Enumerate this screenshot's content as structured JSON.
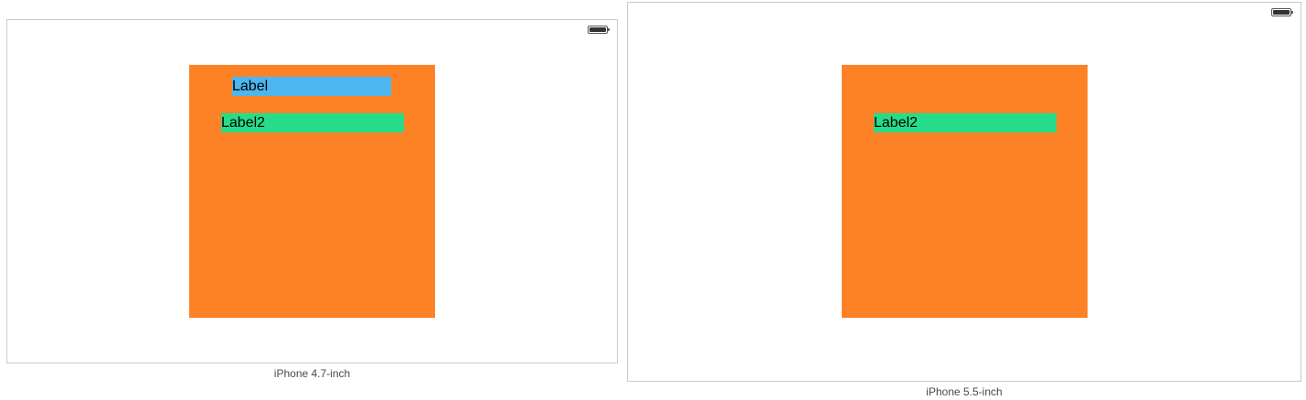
{
  "colors": {
    "orange_view": "#fd8226",
    "label_blue": "#4cb6f0",
    "label_green": "#26dc8a",
    "frame_border": "#c9c9c9",
    "caption_text": "#4a4a4a"
  },
  "devices": [
    {
      "caption": "iPhone 4.7-inch",
      "status_icon": "battery-icon",
      "labels": [
        {
          "text": "Label",
          "color": "blue"
        },
        {
          "text": "Label2",
          "color": "green"
        }
      ]
    },
    {
      "caption": "iPhone 5.5-inch",
      "status_icon": "battery-icon",
      "labels": [
        {
          "text": "Label2",
          "color": "green"
        }
      ]
    }
  ]
}
